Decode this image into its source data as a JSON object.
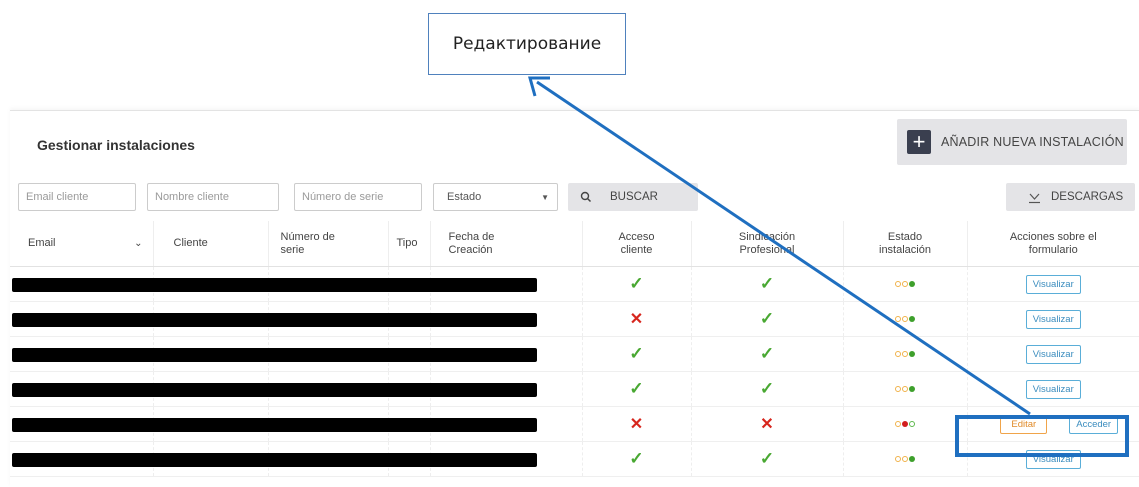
{
  "annotation": {
    "callout_text": "Редактирование"
  },
  "header": {
    "title": "Gestionar instalaciones",
    "add_button": {
      "icon": "plus-icon",
      "label": "AÑADIR NUEVA INSTALACIÓN"
    }
  },
  "filters": {
    "email_placeholder": "Email cliente",
    "name_placeholder": "Nombre cliente",
    "serial_placeholder": "Número de serie",
    "status_select": "Estado",
    "search_label": "BUSCAR",
    "download_label": "DESCARGAS"
  },
  "table": {
    "columns": [
      "Email",
      "Cliente",
      "Número de serie",
      "Tipo",
      "Fecha de Creación",
      "Acceso cliente",
      "Sindicación Profesional",
      "Estado instalación",
      "Acciones sobre el formulario"
    ],
    "rows": [
      {
        "acceso": "check",
        "sindicacion": "check",
        "estado": "green",
        "actions": [
          "Visualizar"
        ]
      },
      {
        "acceso": "cross",
        "sindicacion": "check",
        "estado": "green",
        "actions": [
          "Visualizar"
        ]
      },
      {
        "acceso": "check",
        "sindicacion": "check",
        "estado": "green",
        "actions": [
          "Visualizar"
        ]
      },
      {
        "acceso": "check",
        "sindicacion": "check",
        "estado": "green",
        "actions": [
          "Visualizar"
        ]
      },
      {
        "acceso": "cross",
        "sindicacion": "cross",
        "estado": "red",
        "actions": [
          "Editar",
          "Acceder"
        ]
      },
      {
        "acceso": "check",
        "sindicacion": "check",
        "estado": "green",
        "actions": [
          "Visualizar"
        ]
      }
    ]
  },
  "colors": {
    "check": "#49a832",
    "cross": "#d7261d",
    "annotation_blue": "#1f6fc0"
  }
}
